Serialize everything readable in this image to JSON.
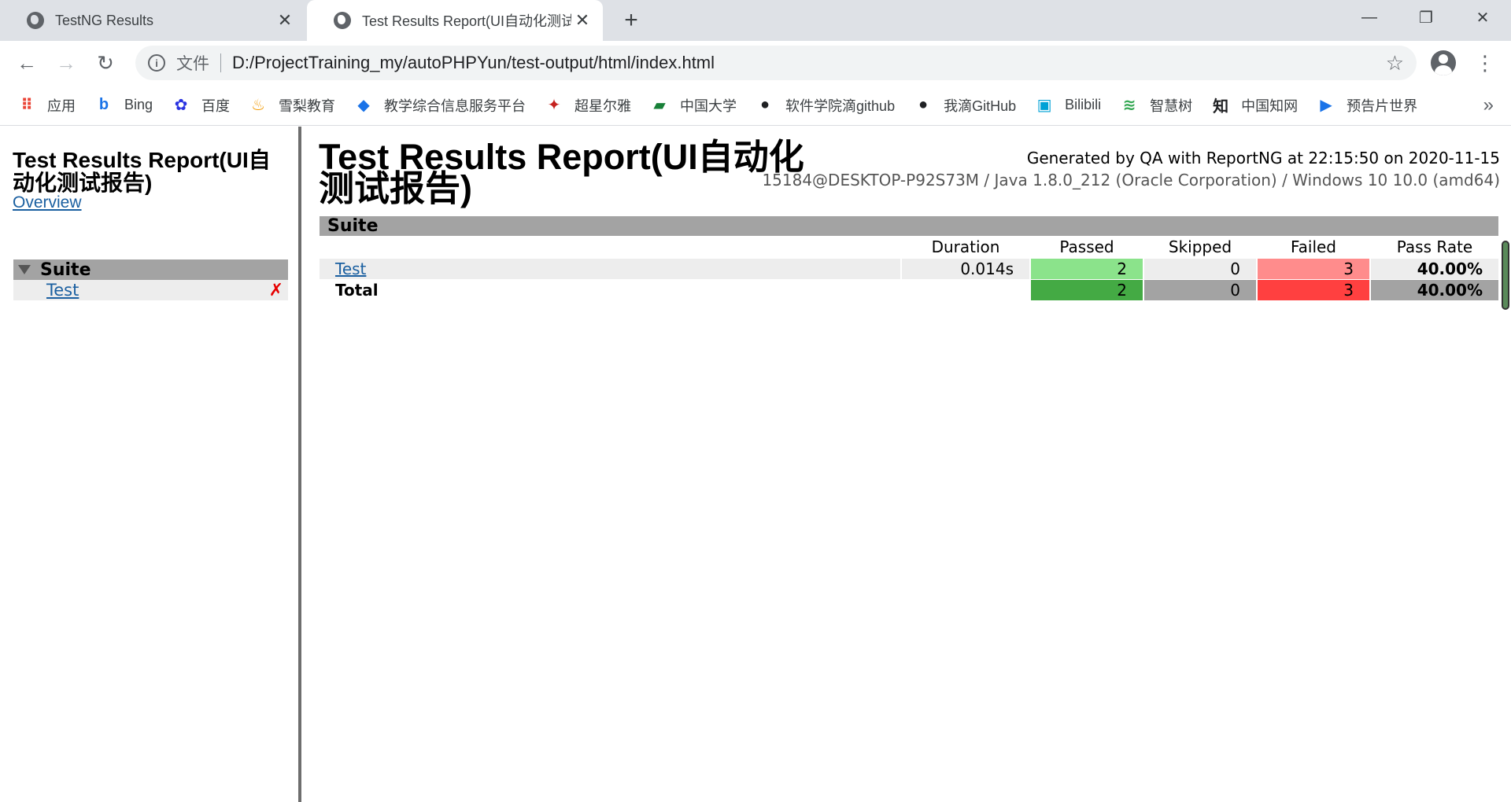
{
  "browser": {
    "tabs": [
      {
        "title": "TestNG Results",
        "active": false
      },
      {
        "title": "Test Results Report(UI自动化测试",
        "active": true
      }
    ],
    "window_controls": {
      "minimize": "—",
      "restore": "❐",
      "close": "✕"
    },
    "address": {
      "scheme_label": "文件",
      "url": "D:/ProjectTraining_my/autoPHPYun/test-output/html/index.html"
    },
    "bookmarks": [
      {
        "label": "应用",
        "icon": "apps-grid-icon",
        "color": "#ea4335"
      },
      {
        "label": "Bing",
        "icon": "bing-icon",
        "color": "#1a73e8"
      },
      {
        "label": "百度",
        "icon": "baidu-paw-icon",
        "color": "#2932e1"
      },
      {
        "label": "雪梨教育",
        "icon": "flame-icon",
        "color": "#f29900"
      },
      {
        "label": "教学综合信息服务平台",
        "icon": "diamond-icon",
        "color": "#1a73e8"
      },
      {
        "label": "超星尔雅",
        "icon": "chaoxing-icon",
        "color": "#c5221f"
      },
      {
        "label": "中国大学",
        "icon": "book-icon",
        "color": "#188038"
      },
      {
        "label": "软件学院滴github",
        "icon": "github-icon",
        "color": "#202124"
      },
      {
        "label": "我滴GitHub",
        "icon": "github-icon",
        "color": "#202124"
      },
      {
        "label": "Bilibili",
        "icon": "bilibili-tv-icon",
        "color": "#00a1d6"
      },
      {
        "label": "智慧树",
        "icon": "soundwave-icon",
        "color": "#34a853"
      },
      {
        "label": "中国知网",
        "icon": "zhi-icon",
        "color": "#202124"
      },
      {
        "label": "预告片世界",
        "icon": "play-icon",
        "color": "#1a73e8"
      }
    ]
  },
  "sidebar": {
    "title": "Test Results Report(UI自动化测试报告)",
    "overview_link": "Overview",
    "suite_label": "Suite",
    "test_link": "Test",
    "fail_mark": "✗"
  },
  "report": {
    "title": "Test Results Report(UI自动化测试报告)",
    "generated_by": "Generated by QA with ReportNG at 22:15:50 on 2020-11-15",
    "environment": "15184@DESKTOP-P92S73M / Java 1.8.0_212 (Oracle Corporation) / Windows 10 10.0 (amd64)",
    "suite_header": "Suite",
    "columns": [
      "Duration",
      "Passed",
      "Skipped",
      "Failed",
      "Pass Rate"
    ],
    "rows": [
      {
        "name": "Test",
        "duration": "0.014s",
        "passed": "2",
        "skipped": "0",
        "failed": "3",
        "pass_rate": "40.00%"
      }
    ],
    "total": {
      "name": "Total",
      "passed": "2",
      "skipped": "0",
      "failed": "3",
      "pass_rate": "40.00%"
    }
  }
}
